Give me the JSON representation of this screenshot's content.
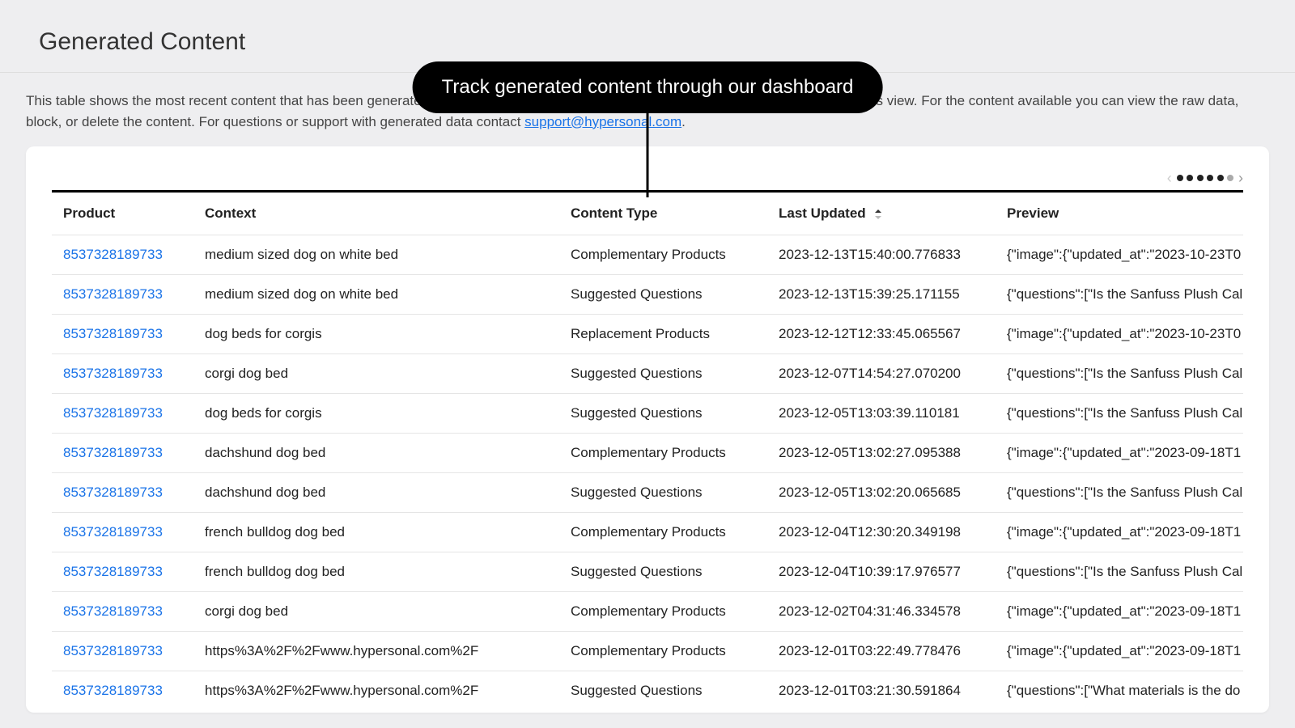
{
  "page": {
    "title": "Generated Content",
    "description_prefix": "This table shows the most recent content that has been generated by Hypersonal. We are working on making more content accessible in this view. For the content available you can view the raw data, block, or delete the content. For questions or support with generated data contact ",
    "support_email": "support@hypersonal.com",
    "description_suffix": "."
  },
  "callout": "Track generated content through our dashboard",
  "table": {
    "columns": {
      "product": "Product",
      "context": "Context",
      "content_type": "Content Type",
      "last_updated": "Last Updated",
      "preview": "Preview"
    },
    "sort_icon": "sort-ascending-icon",
    "rows": [
      {
        "product": "8537328189733",
        "context": "medium sized dog on white bed",
        "content_type": "Complementary Products",
        "last_updated": "2023-12-13T15:40:00.776833",
        "preview": "{\"image\":{\"updated_at\":\"2023-10-23T0"
      },
      {
        "product": "8537328189733",
        "context": "medium sized dog on white bed",
        "content_type": "Suggested Questions",
        "last_updated": "2023-12-13T15:39:25.171155",
        "preview": "{\"questions\":[\"Is the Sanfuss Plush Calr"
      },
      {
        "product": "8537328189733",
        "context": "dog beds for corgis",
        "content_type": "Replacement Products",
        "last_updated": "2023-12-12T12:33:45.065567",
        "preview": "{\"image\":{\"updated_at\":\"2023-10-23T0"
      },
      {
        "product": "8537328189733",
        "context": "corgi dog bed",
        "content_type": "Suggested Questions",
        "last_updated": "2023-12-07T14:54:27.070200",
        "preview": "{\"questions\":[\"Is the Sanfuss Plush Calr"
      },
      {
        "product": "8537328189733",
        "context": "dog beds for corgis",
        "content_type": "Suggested Questions",
        "last_updated": "2023-12-05T13:03:39.110181",
        "preview": "{\"questions\":[\"Is the Sanfuss Plush Calr"
      },
      {
        "product": "8537328189733",
        "context": "dachshund dog bed",
        "content_type": "Complementary Products",
        "last_updated": "2023-12-05T13:02:27.095388",
        "preview": "{\"image\":{\"updated_at\":\"2023-09-18T1"
      },
      {
        "product": "8537328189733",
        "context": "dachshund dog bed",
        "content_type": "Suggested Questions",
        "last_updated": "2023-12-05T13:02:20.065685",
        "preview": "{\"questions\":[\"Is the Sanfuss Plush Calr"
      },
      {
        "product": "8537328189733",
        "context": "french bulldog dog bed",
        "content_type": "Complementary Products",
        "last_updated": "2023-12-04T12:30:20.349198",
        "preview": "{\"image\":{\"updated_at\":\"2023-09-18T1"
      },
      {
        "product": "8537328189733",
        "context": "french bulldog dog bed",
        "content_type": "Suggested Questions",
        "last_updated": "2023-12-04T10:39:17.976577",
        "preview": "{\"questions\":[\"Is the Sanfuss Plush Calr"
      },
      {
        "product": "8537328189733",
        "context": "corgi dog bed",
        "content_type": "Complementary Products",
        "last_updated": "2023-12-02T04:31:46.334578",
        "preview": "{\"image\":{\"updated_at\":\"2023-09-18T1"
      },
      {
        "product": "8537328189733",
        "context": "https%3A%2F%2Fwww.hypersonal.com%2F",
        "content_type": "Complementary Products",
        "last_updated": "2023-12-01T03:22:49.778476",
        "preview": "{\"image\":{\"updated_at\":\"2023-09-18T1"
      },
      {
        "product": "8537328189733",
        "context": "https%3A%2F%2Fwww.hypersonal.com%2F",
        "content_type": "Suggested Questions",
        "last_updated": "2023-12-01T03:21:30.591864",
        "preview": "{\"questions\":[\"What materials is the do"
      }
    ]
  },
  "pagination": {
    "prev_disabled": true,
    "dots": [
      "active",
      "active",
      "active",
      "active",
      "active",
      "inactive"
    ]
  }
}
